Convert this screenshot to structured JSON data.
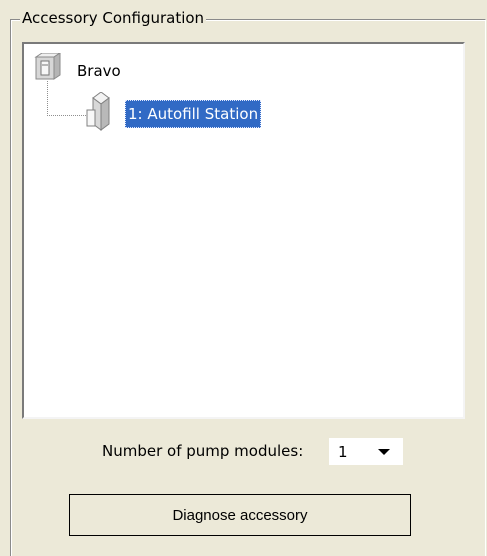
{
  "group": {
    "title": "Accessory Configuration"
  },
  "tree": {
    "root": {
      "label": "Bravo",
      "icon": "device-icon"
    },
    "child": {
      "label": "1: Autofill Station",
      "icon": "module-icon",
      "selected": true
    }
  },
  "pump_modules": {
    "label": "Number of pump modules:",
    "value": "1"
  },
  "buttons": {
    "diagnose": "Diagnose accessory"
  },
  "colors": {
    "window_bg": "#ece9d8",
    "selection_bg": "#316ac5",
    "selection_text": "#ffffff"
  }
}
